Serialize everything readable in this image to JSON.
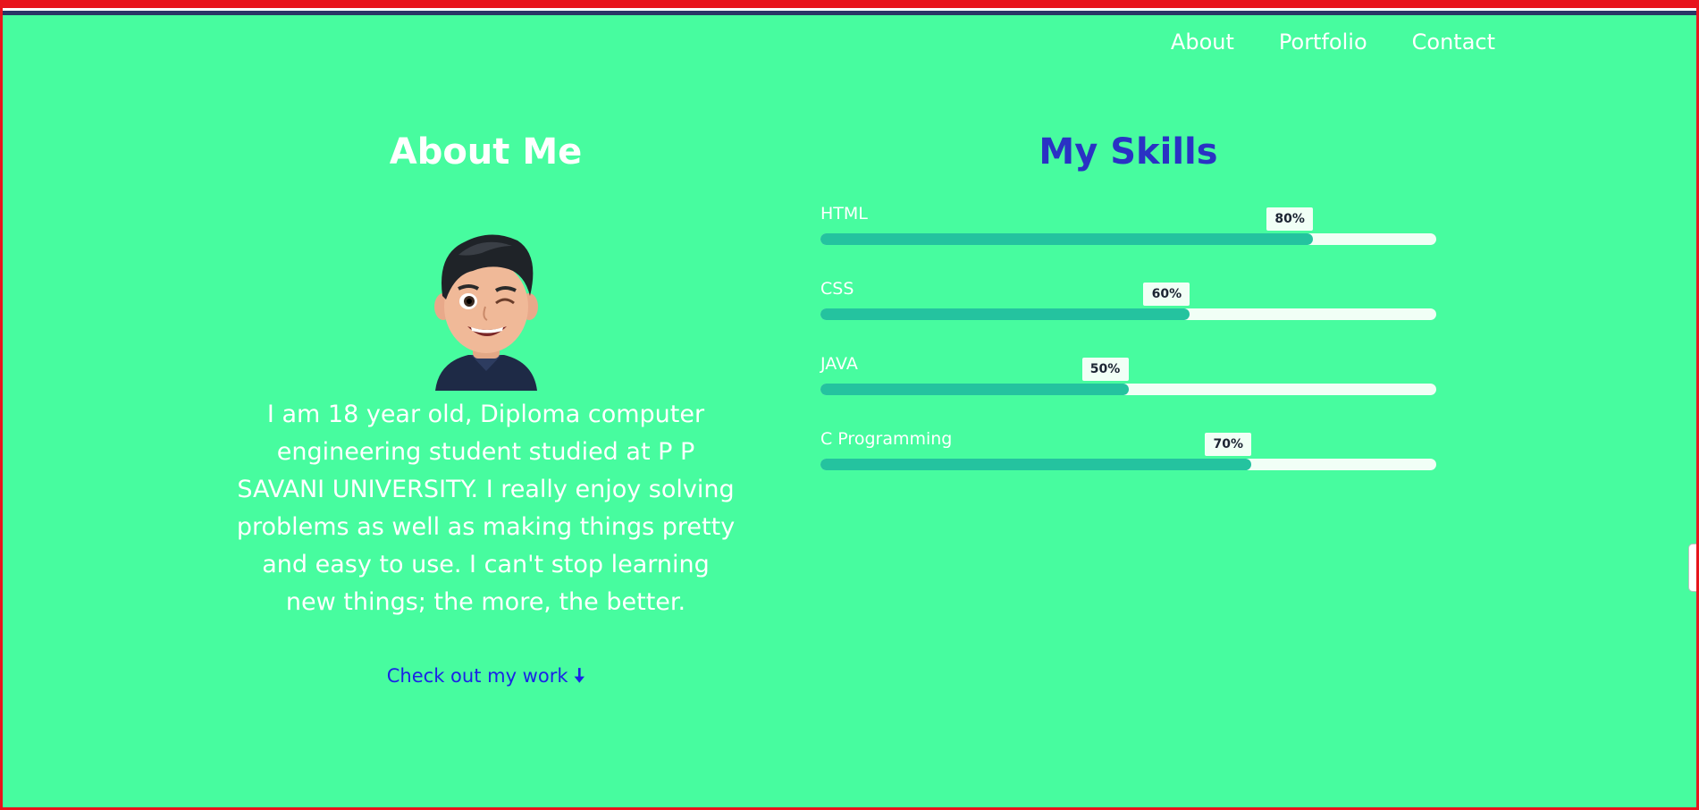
{
  "nav": {
    "items": [
      "About",
      "Portfolio",
      "Contact"
    ]
  },
  "about": {
    "heading": "About Me",
    "bio": "I am 18 year old, Diploma computer engineering student studied at P P SAVANI UNIVERSITY. I really enjoy solving problems as well as making things pretty and easy to use. I can't stop learning new things; the more, the better.",
    "cta": "Check out my work",
    "cta_icon": "arrow-down-icon"
  },
  "skills": {
    "heading": "My Skills",
    "items": [
      {
        "name": "HTML",
        "percent": 80,
        "label": "80%"
      },
      {
        "name": "CSS",
        "percent": 60,
        "label": "60%"
      },
      {
        "name": "JAVA",
        "percent": 50,
        "label": "50%"
      },
      {
        "name": "C Programming",
        "percent": 70,
        "label": "70%"
      }
    ]
  },
  "colors": {
    "background": "#47fc9f",
    "skills_heading": "#2a32c4",
    "bar_fill": "#24c39f",
    "bar_track": "#f1fff6",
    "link": "#1b23e6",
    "border": "#e8141c"
  }
}
